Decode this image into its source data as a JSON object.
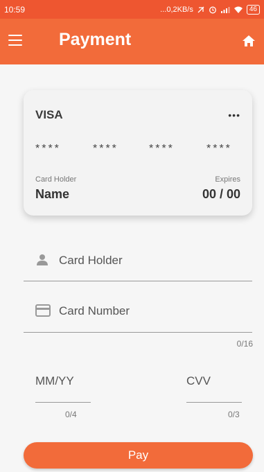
{
  "status_bar": {
    "time": "10:59",
    "network_speed": "...0,2KB/s",
    "battery": "46"
  },
  "app_bar": {
    "title": "Payment"
  },
  "card": {
    "brand": "VISA",
    "more": "•••",
    "number_groups": [
      "****",
      "****",
      "****",
      "****"
    ],
    "holder_label": "Card Holder",
    "holder_value": "Name",
    "expires_label": "Expires",
    "expires_value": "00 / 00"
  },
  "form": {
    "card_holder_placeholder": "Card Holder",
    "card_number_placeholder": "Card Number",
    "card_number_counter": "0/16",
    "expiry_placeholder": "MM/YY",
    "expiry_counter": "0/4",
    "cvv_placeholder": "CVV",
    "cvv_counter": "0/3"
  },
  "pay_button_label": "Pay",
  "colors": {
    "primary": "#f26b3a",
    "status_bar": "#ee5630",
    "background": "#f6f6f6"
  }
}
